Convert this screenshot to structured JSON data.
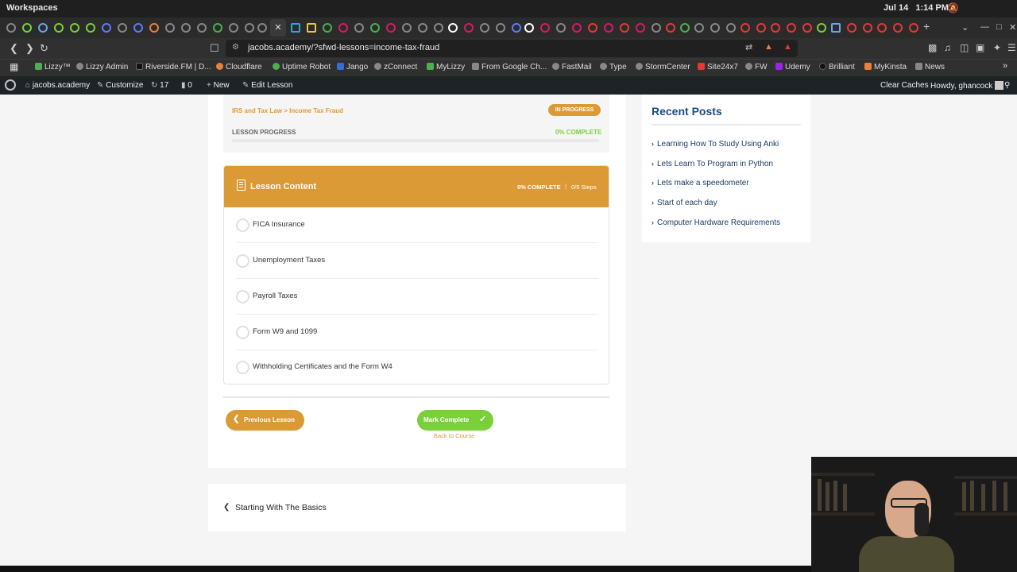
{
  "os": {
    "workspace_label": "Workspaces",
    "date": "Jul 14",
    "time": "1:14 PM"
  },
  "browser": {
    "url": "jacobs.academy/?sfwd-lessons=income-tax-fraud",
    "bookmarks": [
      "Lizzy™",
      "Lizzy Admin",
      "Riverside.FM | D...",
      "Cloudflare",
      "Uptime Robot",
      "Jango",
      "zConnect",
      "MyLizzy",
      "From Google Ch...",
      "FastMail",
      "Type",
      "StormCenter",
      "Site24x7",
      "FW",
      "Udemy",
      "Brilliant",
      "MyKinsta",
      "News"
    ]
  },
  "wpbar": {
    "site": "jacobs.academy",
    "customize": "Customize",
    "updates": "17",
    "comments": "0",
    "new": "New",
    "edit": "Edit Lesson",
    "clear_caches": "Clear Caches",
    "howdy": "Howdy, ghancock"
  },
  "lesson": {
    "breadcrumb": "IRS and Tax Law > Income Tax Fraud",
    "status": "IN PROGRESS",
    "progress_label": "LESSON PROGRESS",
    "progress_value": "0% COMPLETE",
    "progress_fraction": 0,
    "content_title": "Lesson Content",
    "content_complete": "0% COMPLETE",
    "content_steps": "0/5 Steps",
    "topics": [
      "FICA Insurance",
      "Unemployment Taxes",
      "Payroll Taxes",
      "Form W9 and 1099",
      "Withholding Certificates and the Form W4"
    ],
    "prev_button": "Previous Lesson",
    "mark_button": "Mark Complete",
    "back_link": "Back to Course",
    "next_post": "Starting With The Basics"
  },
  "sidebar": {
    "title": "Recent Posts",
    "posts": [
      "Learning How To Study Using Anki",
      "Lets Learn To Program in Python",
      "Lets make a speedometer",
      "Start of each day",
      "Computer Hardware Requirements"
    ]
  },
  "colors": {
    "accent": "#dc9a36",
    "success": "#7ad03a",
    "title_blue": "#1a4b84"
  }
}
